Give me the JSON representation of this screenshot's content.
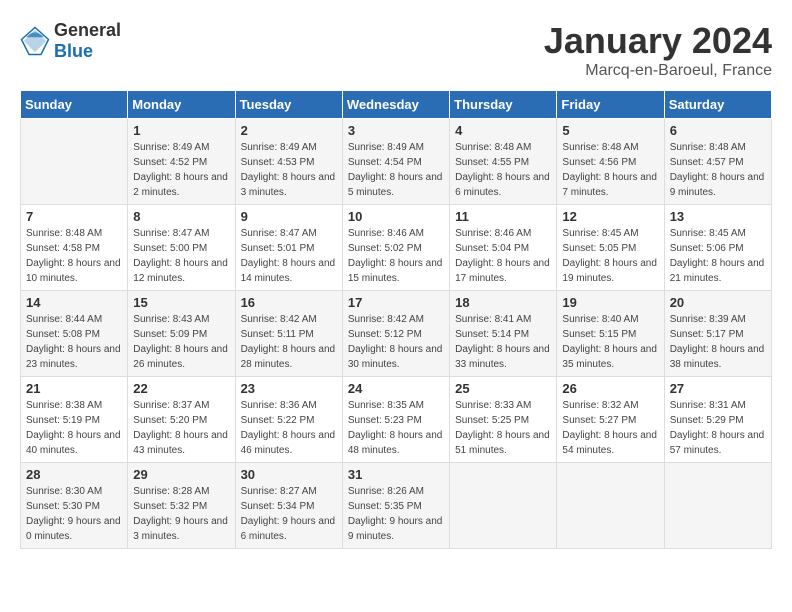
{
  "header": {
    "logo_general": "General",
    "logo_blue": "Blue",
    "title": "January 2024",
    "subtitle": "Marcq-en-Baroeul, France"
  },
  "days_of_week": [
    "Sunday",
    "Monday",
    "Tuesday",
    "Wednesday",
    "Thursday",
    "Friday",
    "Saturday"
  ],
  "weeks": [
    [
      {
        "day": "",
        "sunrise": "",
        "sunset": "",
        "daylight": ""
      },
      {
        "day": "1",
        "sunrise": "Sunrise: 8:49 AM",
        "sunset": "Sunset: 4:52 PM",
        "daylight": "Daylight: 8 hours and 2 minutes."
      },
      {
        "day": "2",
        "sunrise": "Sunrise: 8:49 AM",
        "sunset": "Sunset: 4:53 PM",
        "daylight": "Daylight: 8 hours and 3 minutes."
      },
      {
        "day": "3",
        "sunrise": "Sunrise: 8:49 AM",
        "sunset": "Sunset: 4:54 PM",
        "daylight": "Daylight: 8 hours and 5 minutes."
      },
      {
        "day": "4",
        "sunrise": "Sunrise: 8:48 AM",
        "sunset": "Sunset: 4:55 PM",
        "daylight": "Daylight: 8 hours and 6 minutes."
      },
      {
        "day": "5",
        "sunrise": "Sunrise: 8:48 AM",
        "sunset": "Sunset: 4:56 PM",
        "daylight": "Daylight: 8 hours and 7 minutes."
      },
      {
        "day": "6",
        "sunrise": "Sunrise: 8:48 AM",
        "sunset": "Sunset: 4:57 PM",
        "daylight": "Daylight: 8 hours and 9 minutes."
      }
    ],
    [
      {
        "day": "7",
        "sunrise": "Sunrise: 8:48 AM",
        "sunset": "Sunset: 4:58 PM",
        "daylight": "Daylight: 8 hours and 10 minutes."
      },
      {
        "day": "8",
        "sunrise": "Sunrise: 8:47 AM",
        "sunset": "Sunset: 5:00 PM",
        "daylight": "Daylight: 8 hours and 12 minutes."
      },
      {
        "day": "9",
        "sunrise": "Sunrise: 8:47 AM",
        "sunset": "Sunset: 5:01 PM",
        "daylight": "Daylight: 8 hours and 14 minutes."
      },
      {
        "day": "10",
        "sunrise": "Sunrise: 8:46 AM",
        "sunset": "Sunset: 5:02 PM",
        "daylight": "Daylight: 8 hours and 15 minutes."
      },
      {
        "day": "11",
        "sunrise": "Sunrise: 8:46 AM",
        "sunset": "Sunset: 5:04 PM",
        "daylight": "Daylight: 8 hours and 17 minutes."
      },
      {
        "day": "12",
        "sunrise": "Sunrise: 8:45 AM",
        "sunset": "Sunset: 5:05 PM",
        "daylight": "Daylight: 8 hours and 19 minutes."
      },
      {
        "day": "13",
        "sunrise": "Sunrise: 8:45 AM",
        "sunset": "Sunset: 5:06 PM",
        "daylight": "Daylight: 8 hours and 21 minutes."
      }
    ],
    [
      {
        "day": "14",
        "sunrise": "Sunrise: 8:44 AM",
        "sunset": "Sunset: 5:08 PM",
        "daylight": "Daylight: 8 hours and 23 minutes."
      },
      {
        "day": "15",
        "sunrise": "Sunrise: 8:43 AM",
        "sunset": "Sunset: 5:09 PM",
        "daylight": "Daylight: 8 hours and 26 minutes."
      },
      {
        "day": "16",
        "sunrise": "Sunrise: 8:42 AM",
        "sunset": "Sunset: 5:11 PM",
        "daylight": "Daylight: 8 hours and 28 minutes."
      },
      {
        "day": "17",
        "sunrise": "Sunrise: 8:42 AM",
        "sunset": "Sunset: 5:12 PM",
        "daylight": "Daylight: 8 hours and 30 minutes."
      },
      {
        "day": "18",
        "sunrise": "Sunrise: 8:41 AM",
        "sunset": "Sunset: 5:14 PM",
        "daylight": "Daylight: 8 hours and 33 minutes."
      },
      {
        "day": "19",
        "sunrise": "Sunrise: 8:40 AM",
        "sunset": "Sunset: 5:15 PM",
        "daylight": "Daylight: 8 hours and 35 minutes."
      },
      {
        "day": "20",
        "sunrise": "Sunrise: 8:39 AM",
        "sunset": "Sunset: 5:17 PM",
        "daylight": "Daylight: 8 hours and 38 minutes."
      }
    ],
    [
      {
        "day": "21",
        "sunrise": "Sunrise: 8:38 AM",
        "sunset": "Sunset: 5:19 PM",
        "daylight": "Daylight: 8 hours and 40 minutes."
      },
      {
        "day": "22",
        "sunrise": "Sunrise: 8:37 AM",
        "sunset": "Sunset: 5:20 PM",
        "daylight": "Daylight: 8 hours and 43 minutes."
      },
      {
        "day": "23",
        "sunrise": "Sunrise: 8:36 AM",
        "sunset": "Sunset: 5:22 PM",
        "daylight": "Daylight: 8 hours and 46 minutes."
      },
      {
        "day": "24",
        "sunrise": "Sunrise: 8:35 AM",
        "sunset": "Sunset: 5:23 PM",
        "daylight": "Daylight: 8 hours and 48 minutes."
      },
      {
        "day": "25",
        "sunrise": "Sunrise: 8:33 AM",
        "sunset": "Sunset: 5:25 PM",
        "daylight": "Daylight: 8 hours and 51 minutes."
      },
      {
        "day": "26",
        "sunrise": "Sunrise: 8:32 AM",
        "sunset": "Sunset: 5:27 PM",
        "daylight": "Daylight: 8 hours and 54 minutes."
      },
      {
        "day": "27",
        "sunrise": "Sunrise: 8:31 AM",
        "sunset": "Sunset: 5:29 PM",
        "daylight": "Daylight: 8 hours and 57 minutes."
      }
    ],
    [
      {
        "day": "28",
        "sunrise": "Sunrise: 8:30 AM",
        "sunset": "Sunset: 5:30 PM",
        "daylight": "Daylight: 9 hours and 0 minutes."
      },
      {
        "day": "29",
        "sunrise": "Sunrise: 8:28 AM",
        "sunset": "Sunset: 5:32 PM",
        "daylight": "Daylight: 9 hours and 3 minutes."
      },
      {
        "day": "30",
        "sunrise": "Sunrise: 8:27 AM",
        "sunset": "Sunset: 5:34 PM",
        "daylight": "Daylight: 9 hours and 6 minutes."
      },
      {
        "day": "31",
        "sunrise": "Sunrise: 8:26 AM",
        "sunset": "Sunset: 5:35 PM",
        "daylight": "Daylight: 9 hours and 9 minutes."
      },
      {
        "day": "",
        "sunrise": "",
        "sunset": "",
        "daylight": ""
      },
      {
        "day": "",
        "sunrise": "",
        "sunset": "",
        "daylight": ""
      },
      {
        "day": "",
        "sunrise": "",
        "sunset": "",
        "daylight": ""
      }
    ]
  ]
}
